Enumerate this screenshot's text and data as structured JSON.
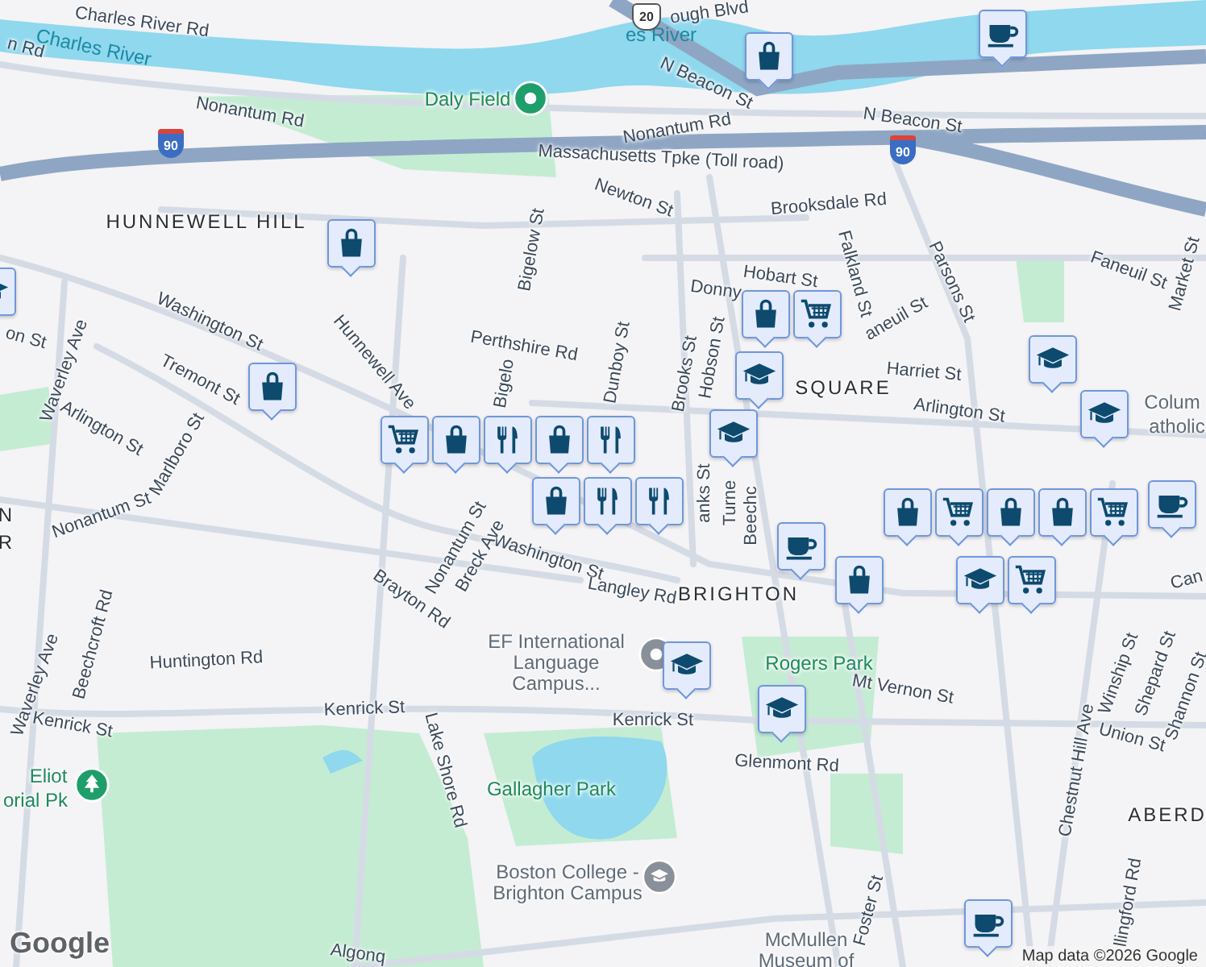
{
  "map": {
    "labels": [
      {
        "text": "Charles River Rd",
        "kind": "street"
      },
      {
        "text": "Charles River",
        "kind": "water"
      },
      {
        "text": "n Rd",
        "kind": "street"
      },
      {
        "text": "Nonantum Rd",
        "kind": "street"
      },
      {
        "text": "Daly Field",
        "kind": "park"
      },
      {
        "text": "Massachusetts Tpke (Toll road)",
        "kind": "street"
      },
      {
        "text": "HUNNEWELL HILL",
        "kind": "area"
      },
      {
        "text": "Newton St",
        "kind": "street"
      },
      {
        "text": "Brooksdale Rd",
        "kind": "street"
      },
      {
        "text": "Hobart St",
        "kind": "street"
      },
      {
        "text": "Falkland St",
        "kind": "street"
      },
      {
        "text": "Faneuil St",
        "kind": "street"
      },
      {
        "text": "Market St",
        "kind": "street"
      },
      {
        "text": "N Beacon St",
        "kind": "street"
      },
      {
        "text": "N Beacon St",
        "kind": "street"
      },
      {
        "text": "Nonantum Rd",
        "kind": "street"
      },
      {
        "text": "ough Blvd",
        "kind": "street"
      },
      {
        "text": "es River",
        "kind": "water"
      },
      {
        "text": "Washington St",
        "kind": "street"
      },
      {
        "text": "Waverley Ave",
        "kind": "street"
      },
      {
        "text": "Hunnewell Ave",
        "kind": "street"
      },
      {
        "text": "Bigelow St",
        "kind": "street"
      },
      {
        "text": "Perthshire Rd",
        "kind": "street"
      },
      {
        "text": "Dunboy St",
        "kind": "street"
      },
      {
        "text": "Brooks St",
        "kind": "street"
      },
      {
        "text": "Hobson St",
        "kind": "street"
      },
      {
        "text": "Donny",
        "kind": "street"
      },
      {
        "text": "aneuil St",
        "kind": "street"
      },
      {
        "text": "Parsons St",
        "kind": "street"
      },
      {
        "text": "SQUARE",
        "kind": "area"
      },
      {
        "text": "Arlington St",
        "kind": "street"
      },
      {
        "text": "Harriet St",
        "kind": "street"
      },
      {
        "text": "Colum",
        "kind": "poi"
      },
      {
        "text": "atholic",
        "kind": "poi"
      },
      {
        "text": "Tremont St",
        "kind": "street"
      },
      {
        "text": "Arlington St",
        "kind": "street"
      },
      {
        "text": "Marlboro St",
        "kind": "street"
      },
      {
        "text": "Nonantum St",
        "kind": "street"
      },
      {
        "text": "N",
        "kind": "area"
      },
      {
        "text": "R",
        "kind": "area"
      },
      {
        "text": "Bigelo",
        "kind": "street"
      },
      {
        "text": "Washington St",
        "kind": "street"
      },
      {
        "text": "Nonantum St",
        "kind": "street"
      },
      {
        "text": "Breck Ave",
        "kind": "street"
      },
      {
        "text": "Langley Rd",
        "kind": "street"
      },
      {
        "text": "Brayton Rd",
        "kind": "street"
      },
      {
        "text": "Huntington Rd",
        "kind": "street"
      },
      {
        "text": "Beechcroft Rd",
        "kind": "street"
      },
      {
        "text": "Waverley Ave",
        "kind": "street"
      },
      {
        "text": "Kenrick St",
        "kind": "street"
      },
      {
        "text": "Kenrick St",
        "kind": "street"
      },
      {
        "text": "Kenrick St",
        "kind": "street"
      },
      {
        "text": "EF International Language Campus...",
        "kind": "poi"
      },
      {
        "text": "Lake Shore Rd",
        "kind": "street"
      },
      {
        "text": "Eliot",
        "kind": "park"
      },
      {
        "text": "orial Pk",
        "kind": "park"
      },
      {
        "text": "Gallagher Park",
        "kind": "park"
      },
      {
        "text": "Boston College - Brighton Campus",
        "kind": "poi"
      },
      {
        "text": "Rogers Park",
        "kind": "park"
      },
      {
        "text": "Mt Vernon St",
        "kind": "street"
      },
      {
        "text": "Glenmont Rd",
        "kind": "street"
      },
      {
        "text": "Union St",
        "kind": "street"
      },
      {
        "text": "Winship St",
        "kind": "street"
      },
      {
        "text": "Shepard St",
        "kind": "street"
      },
      {
        "text": "Shannon St",
        "kind": "street"
      },
      {
        "text": "ABERD",
        "kind": "area"
      },
      {
        "text": "Chestnut Hill Ave",
        "kind": "street"
      },
      {
        "text": "Foster St",
        "kind": "street"
      },
      {
        "text": "llingford Rd",
        "kind": "street"
      },
      {
        "text": "McMullen Museum of",
        "kind": "poi"
      },
      {
        "text": "Algonq",
        "kind": "street"
      },
      {
        "text": "BRIGHTON",
        "kind": "area"
      },
      {
        "text": "Turne",
        "kind": "street"
      },
      {
        "text": "Beechc",
        "kind": "street"
      },
      {
        "text": "anks St",
        "kind": "street"
      },
      {
        "text": "Can",
        "kind": "street"
      },
      {
        "text": "on St",
        "kind": "street"
      }
    ],
    "pins": [
      {
        "kind": "shopping"
      },
      {
        "kind": "cafe"
      },
      {
        "kind": "shopping"
      },
      {
        "kind": "school"
      },
      {
        "kind": "shopping"
      },
      {
        "kind": "grocery"
      },
      {
        "kind": "shopping"
      },
      {
        "kind": "food"
      },
      {
        "kind": "shopping"
      },
      {
        "kind": "food"
      },
      {
        "kind": "shopping"
      },
      {
        "kind": "food"
      },
      {
        "kind": "food"
      },
      {
        "kind": "shopping"
      },
      {
        "kind": "grocery"
      },
      {
        "kind": "school"
      },
      {
        "kind": "school"
      },
      {
        "kind": "school"
      },
      {
        "kind": "school"
      },
      {
        "kind": "cafe"
      },
      {
        "kind": "shopping"
      },
      {
        "kind": "grocery"
      },
      {
        "kind": "shopping"
      },
      {
        "kind": "shopping"
      },
      {
        "kind": "grocery"
      },
      {
        "kind": "cafe"
      },
      {
        "kind": "shopping"
      },
      {
        "kind": "grocery"
      },
      {
        "kind": "school"
      },
      {
        "kind": "school"
      },
      {
        "kind": "school"
      },
      {
        "kind": "cafe"
      }
    ],
    "markers": [
      {
        "kind": "park"
      },
      {
        "kind": "tree"
      },
      {
        "kind": "school"
      },
      {
        "kind": "poi"
      }
    ],
    "shields": [
      {
        "text": "90",
        "kind": "interstate"
      },
      {
        "text": "90",
        "kind": "interstate"
      },
      {
        "text": "20",
        "kind": "us"
      }
    ],
    "logo": "Google",
    "attribution": "Map data ©2026 Google"
  }
}
